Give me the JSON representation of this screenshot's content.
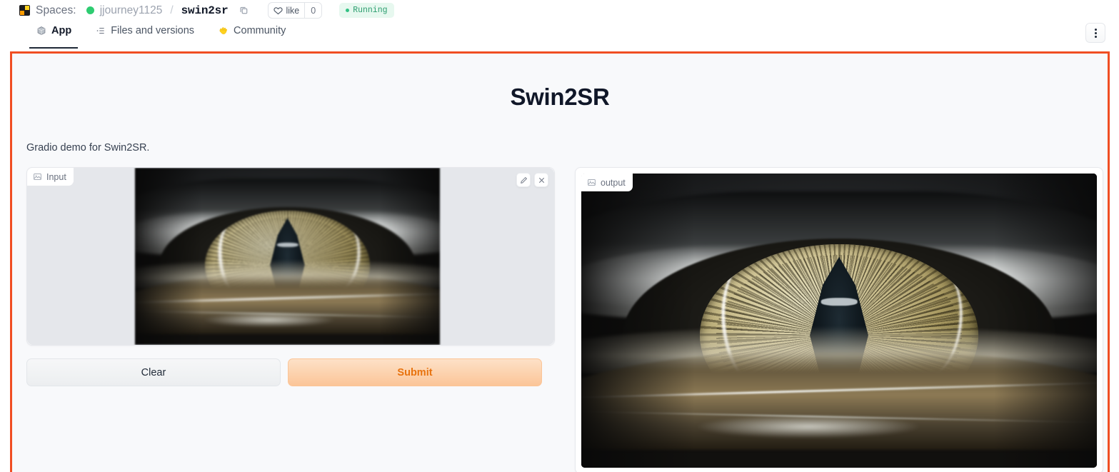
{
  "header": {
    "logo_icon": "hf-spaces-logo-icon",
    "spaces_label": "Spaces:",
    "status_dot_icon": "running-status-dot-icon",
    "owner": "jjourney1125",
    "separator": "/",
    "repo": "swin2sr",
    "copy_icon": "copy-icon",
    "like": {
      "heart_icon": "heart-outline-icon",
      "label": "like",
      "count": "0"
    },
    "badge": {
      "label": "Running",
      "dot_icon": "green-dot-icon",
      "bg_color": "#e7f8ef",
      "text_color": "#2a9d6e"
    }
  },
  "tabs": {
    "items": [
      {
        "label": "App",
        "icon": "cube-icon",
        "active": true
      },
      {
        "label": "Files and versions",
        "icon": "file-list-icon",
        "active": false
      },
      {
        "label": "Community",
        "icon": "hands-icon",
        "active": false
      }
    ],
    "kebab_icon": "kebab-menu-icon"
  },
  "frame": {
    "border_color": "#f04e23",
    "loading_bar_color": "#2b3a4a"
  },
  "app": {
    "title": "Swin2SR",
    "description": "Gradio demo for Swin2SR.",
    "input_panel": {
      "label": "Input",
      "label_icon": "image-icon",
      "tools": [
        {
          "name": "edit-image-button",
          "icon": "pencil-icon"
        },
        {
          "name": "clear-image-button",
          "icon": "close-x-icon"
        }
      ],
      "image_alt": "reptile-eye-input-image",
      "letterbox_color": "#e5e7eb"
    },
    "output_panel": {
      "label": "output",
      "label_icon": "image-icon",
      "image_alt": "reptile-eye-upscaled-output-image"
    },
    "buttons": {
      "clear": "Clear",
      "submit": "Submit",
      "submit_bg_top": "#fde1c7",
      "submit_bg_bottom": "#fbc598",
      "submit_text_color": "#e8730f"
    }
  }
}
